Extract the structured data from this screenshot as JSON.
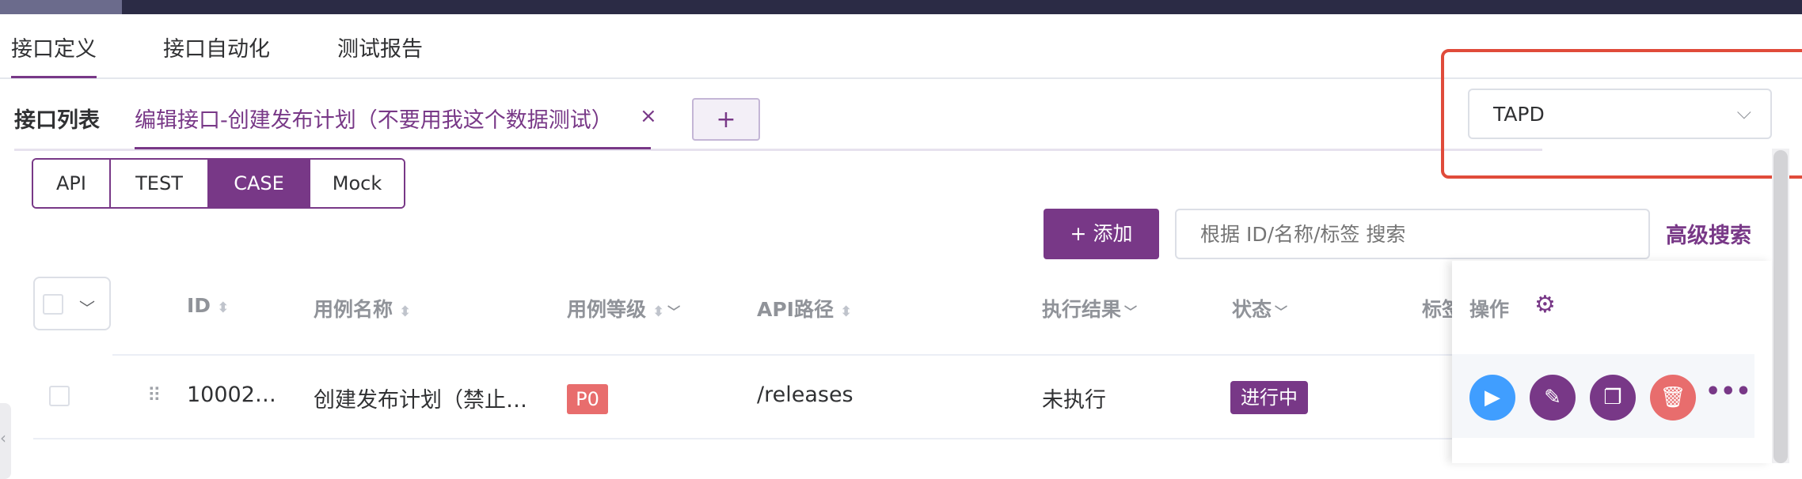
{
  "colors": {
    "accent": "#783887",
    "danger": "#e86d6d",
    "info": "#409eff",
    "topbar": "#2b2b45",
    "highlight": "#e04b3a"
  },
  "main_tabs": [
    "接口定义",
    "接口自动化",
    "测试报告"
  ],
  "sub_tabs": {
    "list_label": "接口列表",
    "edit_label": "编辑接口-创建发布计划（不要用我这个数据测试）",
    "close": "×",
    "add": "+"
  },
  "project_select": {
    "value": "TAPD",
    "icon": "chevron-down-icon"
  },
  "type_tabs": {
    "items": [
      "API",
      "TEST",
      "CASE",
      "Mock"
    ],
    "selected": "CASE"
  },
  "toolbar": {
    "add_label": "+ 添加",
    "search_placeholder": "根据 ID/名称/标签 搜索",
    "advanced_search": "高级搜索"
  },
  "table": {
    "headers": {
      "id": "ID",
      "name": "用例名称",
      "level": "用例等级",
      "path": "API路径",
      "result": "执行结果",
      "status": "状态",
      "tags": "标签",
      "ops": "操作"
    },
    "rows": [
      {
        "id": "10002…",
        "name": "创建发布计划（禁止…",
        "level": "P0",
        "path": "/releases",
        "result": "未执行",
        "status": "进行中"
      }
    ]
  },
  "row_actions": [
    "run-icon",
    "edit-icon",
    "copy-icon",
    "delete-icon",
    "more-icon"
  ]
}
